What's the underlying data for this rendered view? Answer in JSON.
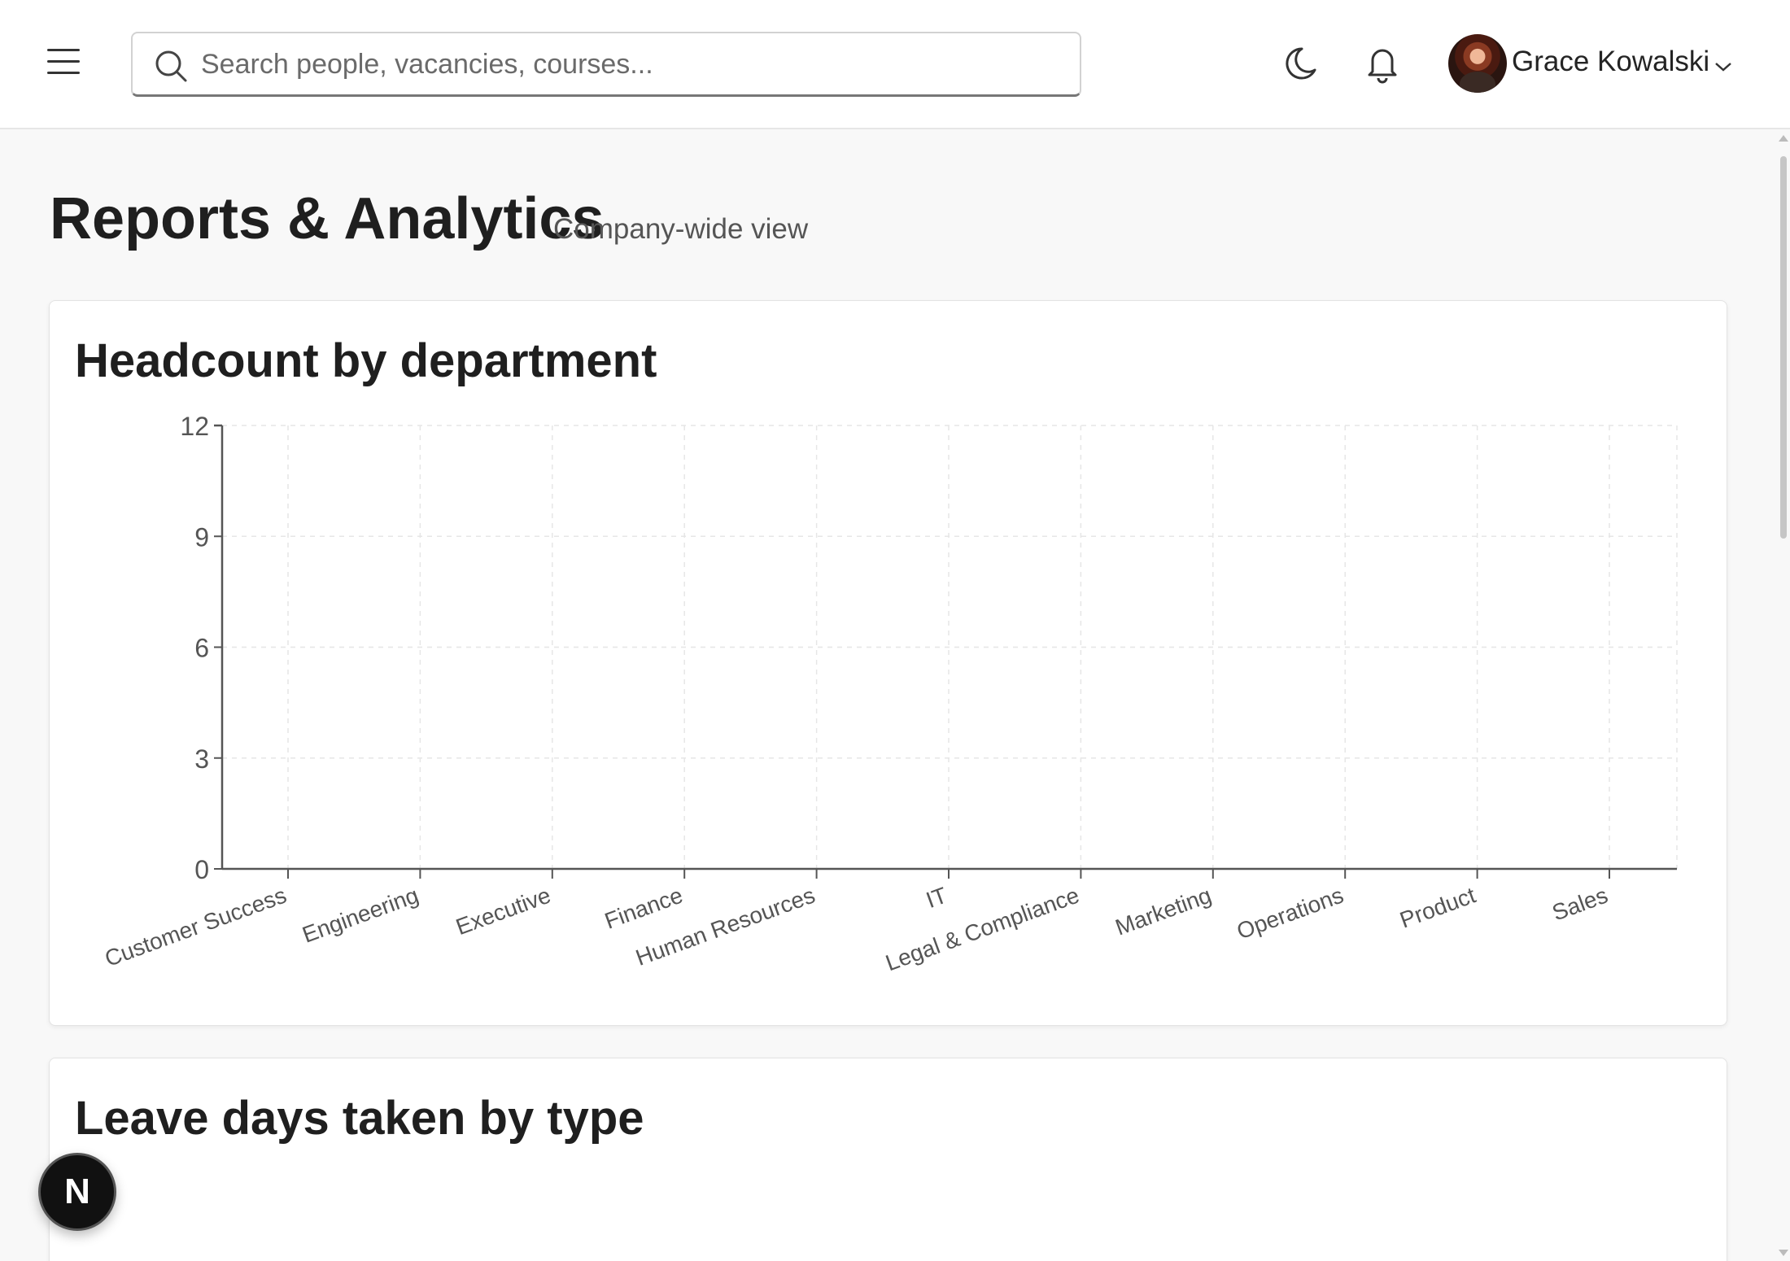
{
  "header": {
    "search_placeholder": "Search people, vacancies, courses...",
    "search_value": "",
    "user_name": "Grace Kowalski"
  },
  "page": {
    "title": "Reports & Analytics",
    "subtitle": "Company-wide view"
  },
  "cards": {
    "headcount_title": "Headcount by department",
    "leave_title": "Leave days taken by type"
  },
  "floating_badge": "N",
  "chart_data": {
    "type": "bar",
    "title": "Headcount by department",
    "categories": [
      "Customer Success",
      "Engineering",
      "Executive",
      "Finance",
      "Human Resources",
      "IT",
      "Legal & Compliance",
      "Marketing",
      "Operations",
      "Product",
      "Sales"
    ],
    "values": [
      0,
      0,
      0,
      0,
      0,
      0,
      0,
      0,
      0,
      0,
      0
    ],
    "ylim": [
      0,
      12
    ],
    "yticks": [
      "0",
      "3",
      "6",
      "9",
      "12"
    ],
    "grid": true,
    "xlabel": "",
    "ylabel": ""
  },
  "colors": {
    "accent": "#1f1f1f",
    "bar": "#4f6bed",
    "grid": "#e6e6e6",
    "axis": "#555555"
  }
}
